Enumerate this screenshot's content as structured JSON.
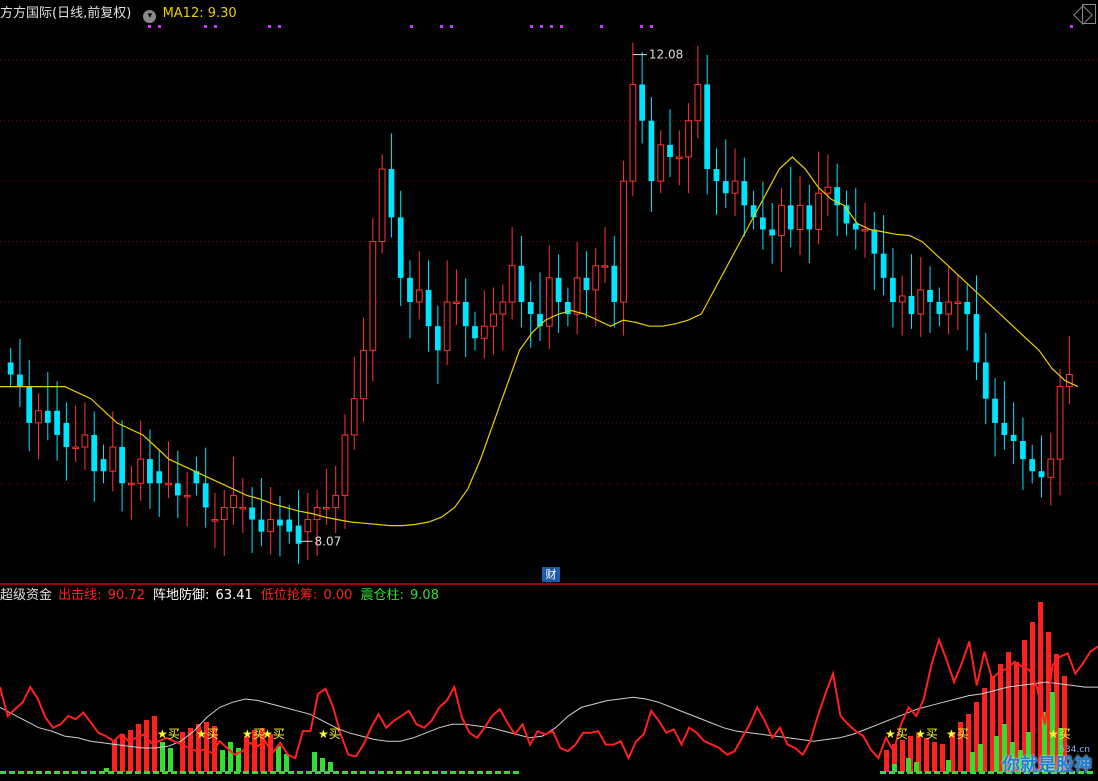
{
  "header": {
    "title": "方方国际(日线,前复权)",
    "ma_label": "MA12: 9.30"
  },
  "annotations": {
    "high": "12.08",
    "low": "8.07",
    "cai": "财"
  },
  "indicator": {
    "name": "超级资金",
    "items": [
      {
        "label": "出击线: ",
        "value": "90.72",
        "color": "#ff2020"
      },
      {
        "label": "阵地防御: ",
        "value": "63.41",
        "color": "#ffffff"
      },
      {
        "label": "低位抢筹: ",
        "value": "0.00",
        "color": "#ff2020"
      },
      {
        "label": "震仓柱: ",
        "value": "9.08",
        "color": "#33dd33"
      }
    ],
    "buy_label": "★买"
  },
  "watermark": {
    "text": "你就是股神",
    "sub": "534.cn"
  },
  "colors": {
    "up": "#ff3333",
    "down": "#00e5ff",
    "ma": "#e8d000",
    "grid": "#8b0000",
    "attack": "#ff2020",
    "defense": "#d0d0d0",
    "shake": "#33dd33",
    "buy": "#ffff33",
    "marker": "#cc33ff"
  },
  "chart_data": [
    {
      "type": "candlestick",
      "title": "方方国际(日线,前复权)",
      "x": [
        1,
        2,
        3,
        4,
        5,
        6,
        7,
        8,
        9,
        10,
        11,
        12,
        13,
        14,
        15,
        16,
        17,
        18,
        19,
        20,
        21,
        22,
        23,
        24,
        25,
        26,
        27,
        28,
        29,
        30,
        31,
        32,
        33,
        34,
        35,
        36,
        37,
        38,
        39,
        40,
        41,
        42,
        43,
        44,
        45,
        46,
        47,
        48,
        49,
        50,
        51,
        52,
        53,
        54,
        55,
        56,
        57,
        58,
        59,
        60,
        61,
        62,
        63,
        64,
        65,
        66,
        67,
        68,
        69,
        70,
        71,
        72,
        73,
        74,
        75,
        76,
        77,
        78,
        79,
        80,
        81,
        82,
        83,
        84,
        85,
        86,
        87,
        88,
        89,
        90,
        91,
        92,
        93,
        94,
        95,
        96,
        97,
        98,
        99,
        100,
        101,
        102,
        103,
        104,
        105,
        106,
        107,
        108,
        109,
        110,
        111,
        112,
        113,
        114,
        115,
        116,
        117,
        118,
        119,
        120,
        121,
        122,
        123,
        124,
        125,
        126,
        127,
        128,
        129,
        130,
        131,
        132,
        133,
        134,
        135,
        136,
        137,
        138,
        139,
        140,
        141,
        142,
        143
      ],
      "open": [
        9.5,
        9.4,
        9.3,
        9.0,
        9.1,
        9.1,
        9.0,
        8.8,
        8.8,
        8.9,
        8.7,
        8.6,
        8.8,
        8.5,
        8.5,
        8.7,
        8.6,
        8.5,
        8.5,
        8.4,
        8.6,
        8.5,
        8.2,
        8.2,
        8.3,
        8.3,
        8.3,
        8.2,
        8.1,
        8.2,
        8.2,
        8.15,
        8.1,
        8.2,
        8.3,
        8.3,
        8.4,
        8.9,
        9.2,
        9.6,
        10.5,
        11.1,
        10.7,
        10.2,
        10.0,
        10.1,
        9.8,
        9.6,
        10.0,
        10.0,
        9.8,
        9.7,
        9.8,
        9.9,
        10.0,
        10.3,
        10.0,
        9.9,
        9.8,
        10.2,
        10.0,
        9.9,
        10.2,
        10.1,
        10.3,
        10.3,
        10.0,
        11.0,
        11.8,
        11.5,
        11.0,
        11.3,
        11.2,
        11.2,
        11.5,
        11.8,
        11.1,
        11.0,
        10.9,
        11.0,
        10.8,
        10.7,
        10.6,
        10.55,
        10.8,
        10.6,
        10.8,
        10.6,
        10.9,
        10.95,
        10.8,
        10.65,
        10.6,
        10.6,
        10.4,
        10.2,
        10.0,
        10.05,
        9.9,
        10.1,
        10.0,
        9.9,
        10.0,
        10.0,
        9.9,
        9.5,
        9.2,
        9.0,
        8.9,
        8.85,
        8.7,
        8.6,
        8.55,
        8.7,
        9.3
      ],
      "close": [
        9.4,
        9.3,
        9.0,
        9.1,
        9.0,
        8.9,
        8.8,
        8.8,
        8.9,
        8.6,
        8.6,
        8.8,
        8.5,
        8.5,
        8.7,
        8.5,
        8.5,
        8.5,
        8.4,
        8.4,
        8.5,
        8.3,
        8.2,
        8.3,
        8.4,
        8.3,
        8.2,
        8.1,
        8.2,
        8.15,
        8.1,
        8.0,
        8.2,
        8.3,
        8.3,
        8.4,
        8.9,
        9.2,
        9.6,
        10.5,
        11.1,
        10.7,
        10.2,
        10.0,
        10.1,
        9.8,
        9.6,
        10.0,
        10.0,
        9.8,
        9.7,
        9.8,
        9.9,
        10.0,
        10.3,
        10.0,
        9.9,
        9.8,
        10.2,
        10.0,
        9.9,
        10.2,
        10.1,
        10.3,
        10.3,
        10.0,
        11.0,
        11.8,
        11.5,
        11.0,
        11.3,
        11.2,
        11.2,
        11.5,
        11.8,
        11.1,
        11.0,
        10.9,
        11.0,
        10.8,
        10.7,
        10.6,
        10.55,
        10.8,
        10.6,
        10.8,
        10.6,
        10.9,
        10.95,
        10.8,
        10.65,
        10.6,
        10.6,
        10.4,
        10.2,
        10.0,
        10.05,
        9.9,
        10.1,
        10.0,
        9.9,
        10.0,
        10.0,
        9.9,
        9.5,
        9.2,
        9.0,
        8.9,
        8.85,
        8.7,
        8.6,
        8.55,
        8.7,
        9.3,
        9.4
      ],
      "ma12": [
        9.3,
        9.3,
        9.3,
        9.3,
        9.3,
        9.3,
        9.25,
        9.2,
        9.1,
        9.0,
        8.95,
        8.9,
        8.8,
        8.7,
        8.65,
        8.6,
        8.55,
        8.5,
        8.45,
        8.4,
        8.37,
        8.33,
        8.3,
        8.27,
        8.25,
        8.22,
        8.2,
        8.18,
        8.17,
        8.16,
        8.15,
        8.15,
        8.16,
        8.18,
        8.22,
        8.3,
        8.45,
        8.7,
        9.0,
        9.3,
        9.6,
        9.75,
        9.85,
        9.9,
        9.93,
        9.9,
        9.85,
        9.8,
        9.85,
        9.83,
        9.8,
        9.8,
        9.82,
        9.85,
        9.9,
        10.1,
        10.3,
        10.5,
        10.7,
        10.9,
        11.1,
        11.2,
        11.1,
        10.95,
        10.85,
        10.8,
        10.65,
        10.6,
        10.58,
        10.56,
        10.55,
        10.5,
        10.4,
        10.3,
        10.2,
        10.1,
        10.0,
        9.9,
        9.8,
        9.7,
        9.6,
        9.45,
        9.35,
        9.3
      ],
      "high_label": 12.08,
      "low_label": 8.07,
      "ylim": [
        7.7,
        12.3
      ]
    },
    {
      "type": "line+bar",
      "title": "超级资金",
      "series": [
        {
          "name": "出击线",
          "values": [
            12,
            -5,
            -1,
            3,
            12,
            5,
            -6,
            -12,
            -10,
            -5,
            -7,
            -3,
            -9,
            -15,
            -17,
            -20,
            -16,
            -20,
            -18,
            -16,
            -21,
            -20,
            -18,
            -20,
            -22,
            -24,
            -26,
            -25,
            -27,
            -20,
            -24,
            -28,
            -26,
            -21,
            -23,
            -20,
            -27,
            -21,
            -28,
            -30,
            -14,
            -14,
            8,
            11,
            0,
            -16,
            -28,
            -29,
            -22,
            -12,
            -4,
            -12,
            -8,
            -5,
            -2,
            -10,
            -12,
            -8,
            0,
            4,
            12,
            -6,
            -15,
            -18,
            -12,
            -5,
            -1,
            -9,
            -16,
            -10,
            -22,
            -14,
            -16,
            -14,
            -24,
            -26,
            -22,
            -15,
            -15,
            -14,
            -22,
            -22,
            -20,
            -30,
            -20,
            -16,
            -2,
            -8,
            -15,
            -13,
            -22,
            -12,
            -15,
            -20,
            -22,
            -24,
            -28,
            -26,
            -18,
            -10,
            0,
            -8,
            -18,
            -12,
            -22,
            -24,
            -28,
            -20,
            -5,
            8,
            20,
            -5,
            -10,
            -14,
            -17,
            -25,
            -30,
            -18,
            -26,
            -10,
            0,
            -5,
            5,
            25,
            40,
            28,
            15,
            26,
            39,
            13,
            33,
            17,
            21,
            23,
            27,
            24,
            22,
            11,
            -10,
            25,
            30,
            32,
            20,
            26,
            33,
            36
          ],
          "color": "#ff2020"
        },
        {
          "name": "阵地防御",
          "values": [
            0,
            -4,
            -8,
            -12,
            -14,
            -17,
            -18,
            -20,
            -21,
            -22,
            -23,
            -24,
            -24,
            -23,
            -20,
            -14,
            -6,
            0,
            3,
            5,
            4,
            2,
            0,
            -2,
            -4,
            -8,
            -12,
            -15,
            -17,
            -19,
            -20,
            -20,
            -18,
            -15,
            -12,
            -10,
            -10,
            -11,
            -12,
            -14,
            -16,
            -18,
            -17,
            -12,
            -5,
            0,
            2,
            4,
            5,
            6,
            5,
            3,
            0,
            -3,
            -6,
            -9,
            -12,
            -14,
            -15,
            -16,
            -17,
            -18,
            -19,
            -20,
            -19,
            -18,
            -16,
            -13,
            -10,
            -7,
            -4,
            -1,
            1,
            3,
            5,
            7,
            8,
            10,
            12,
            13,
            14,
            15,
            14,
            13,
            12,
            12
          ],
          "color": "#d0d0d0"
        },
        {
          "name": "低位抢筹",
          "values": [
            0,
            0,
            0,
            0,
            0,
            0,
            0,
            0,
            0,
            0,
            0,
            0,
            0,
            0,
            0,
            0,
            0,
            0,
            0,
            0,
            0,
            0,
            0,
            0,
            0,
            0,
            0,
            0,
            0,
            0,
            0,
            0,
            0,
            0,
            0,
            0,
            0,
            0,
            0,
            0,
            0,
            0,
            0,
            0,
            0,
            0,
            0,
            0,
            0,
            0,
            0,
            0,
            0,
            0,
            0,
            0,
            0,
            0,
            0,
            0,
            0,
            0,
            0,
            0,
            0,
            0,
            0,
            0,
            0,
            0,
            0,
            0,
            0,
            0,
            0,
            0,
            0,
            0,
            0,
            0,
            0,
            0,
            0,
            0,
            0,
            0,
            0,
            0,
            0,
            0,
            0,
            0,
            0,
            0,
            0,
            0,
            0,
            0,
            0,
            0,
            0,
            0,
            0,
            0,
            0,
            0,
            0,
            0,
            0,
            0,
            0,
            0,
            0,
            0,
            0,
            0,
            0,
            0,
            0,
            0,
            0,
            0,
            0,
            0,
            0,
            0,
            0,
            0,
            0,
            0,
            0,
            0,
            0,
            0,
            0,
            0,
            0,
            0,
            0,
            0,
            0,
            0,
            0,
            0,
            0,
            0
          ],
          "color": "#ff2020"
        },
        {
          "name": "震仓柱",
          "values": [
            0,
            0,
            0,
            0,
            0,
            0,
            0,
            0,
            0,
            0,
            0,
            0,
            0,
            0,
            0,
            0,
            0,
            0,
            0,
            0,
            0,
            0,
            0,
            0,
            0,
            0,
            0,
            0,
            0,
            0,
            0,
            0,
            0,
            0,
            0,
            0,
            0,
            0,
            0,
            0,
            0,
            0,
            0,
            0,
            0,
            0,
            0,
            0,
            0,
            0,
            0,
            0,
            0,
            0,
            0,
            0,
            0,
            0,
            0,
            0,
            0,
            0,
            0,
            0,
            0,
            0,
            0,
            0,
            0,
            0,
            0,
            0,
            0,
            0,
            0,
            0,
            0,
            0,
            0,
            0,
            0,
            0,
            0,
            0,
            0,
            0,
            0,
            0,
            0,
            0,
            0,
            0,
            0,
            0,
            0,
            0,
            0,
            0,
            0,
            0,
            0,
            0,
            0,
            0,
            0,
            0,
            0,
            0,
            0,
            0,
            0,
            0,
            0,
            0,
            0,
            0,
            0,
            0,
            0,
            0,
            0,
            0,
            0,
            0,
            0,
            0,
            0,
            0,
            0,
            0,
            0,
            0,
            0,
            0,
            0,
            0,
            0,
            0,
            0,
            0,
            0,
            0,
            0,
            0,
            0
          ],
          "color": "#33dd33"
        }
      ],
      "ylim": [
        -40,
        60
      ]
    }
  ]
}
